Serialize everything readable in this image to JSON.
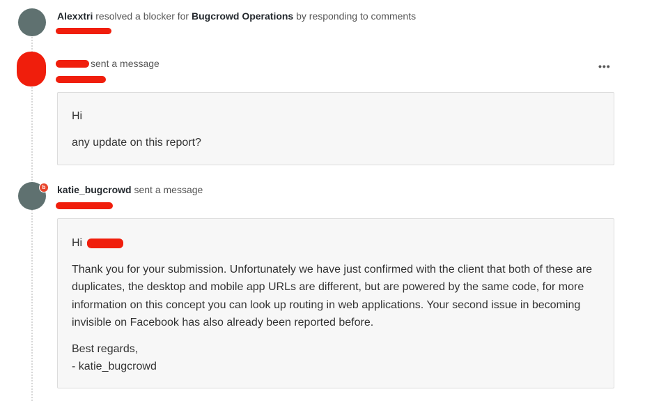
{
  "events": [
    {
      "actor": "Alexxtri",
      "action": "resolved a blocker for",
      "target": "Bugcrowd Operations",
      "suffix": "by responding to comments"
    },
    {
      "actor": "",
      "action": "sent a message",
      "menu_icon": "more-horizontal-icon",
      "message": {
        "greeting": "Hi",
        "body": "any update on this report?"
      }
    },
    {
      "actor": "katie_bugcrowd",
      "action": "sent a message",
      "badge": "b",
      "message": {
        "greeting": "Hi",
        "body": "Thank you for your submission. Unfortunately we have just confirmed with the client that both of these are duplicates, the desktop and mobile app URLs are different, but are powered by the same code, for more information on this concept you can look up routing in web applications. Your second issue in becoming invisible on Facebook has also already been reported before.",
        "closing": "Best regards,",
        "signature": "- katie_bugcrowd"
      }
    }
  ],
  "colors": {
    "avatar": "#5f7170",
    "redaction": "#f01e0c",
    "message_bg": "#f7f7f7",
    "badge": "#e8452c"
  }
}
